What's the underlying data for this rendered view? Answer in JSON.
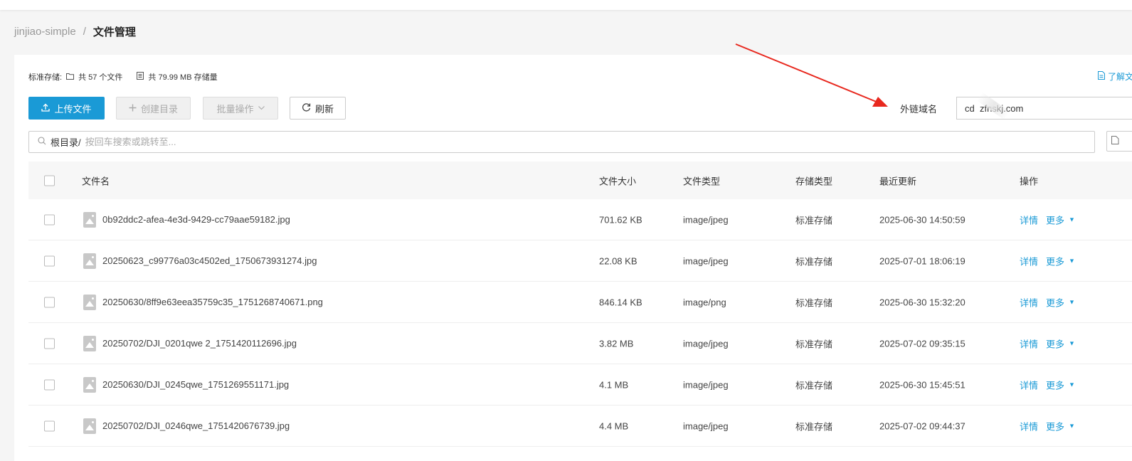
{
  "breadcrumb": {
    "root": "jinjiao-simple",
    "separator": "/",
    "current": "文件管理"
  },
  "stats": {
    "label": "标准存储:",
    "file_count": "共 57 个文件",
    "storage": "共 79.99 MB 存储量"
  },
  "learn_more": "了解文",
  "toolbar": {
    "upload": "上传文件",
    "mkdir": "创建目录",
    "batch": "批量操作",
    "refresh": "刷新"
  },
  "domain": {
    "label": "外链域名",
    "value": "cd  zfnskj.com"
  },
  "search": {
    "prefix": "根目录/",
    "placeholder": "按回车搜索或跳转至..."
  },
  "table": {
    "headers": {
      "name": "文件名",
      "size": "文件大小",
      "type": "文件类型",
      "storage": "存储类型",
      "updated": "最近更新",
      "actions": "操作"
    },
    "rows": [
      {
        "name": "0b92ddc2-afea-4e3d-9429-cc79aae59182.jpg",
        "size": "701.62 KB",
        "type": "image/jpeg",
        "storage": "标准存储",
        "updated": "2025-06-30 14:50:59",
        "detail": "详情",
        "more": "更多"
      },
      {
        "name": "20250623_c99776a03c4502ed_1750673931274.jpg",
        "size": "22.08 KB",
        "type": "image/jpeg",
        "storage": "标准存储",
        "updated": "2025-07-01 18:06:19",
        "detail": "详情",
        "more": "更多"
      },
      {
        "name": "20250630/8ff9e63eea35759c35_1751268740671.png",
        "size": "846.14 KB",
        "type": "image/png",
        "storage": "标准存储",
        "updated": "2025-06-30 15:32:20",
        "detail": "详情",
        "more": "更多"
      },
      {
        "name": "20250702/DJI_0201qwe 2_1751420112696.jpg",
        "size": "3.82 MB",
        "type": "image/jpeg",
        "storage": "标准存储",
        "updated": "2025-07-02 09:35:15",
        "detail": "详情",
        "more": "更多"
      },
      {
        "name": "20250630/DJI_0245qwe_1751269551171.jpg",
        "size": "4.1 MB",
        "type": "image/jpeg",
        "storage": "标准存储",
        "updated": "2025-06-30 15:45:51",
        "detail": "详情",
        "more": "更多"
      },
      {
        "name": "20250702/DJI_0246qwe_1751420676739.jpg",
        "size": "4.4 MB",
        "type": "image/jpeg",
        "storage": "标准存储",
        "updated": "2025-07-02 09:44:37",
        "detail": "详情",
        "more": "更多"
      }
    ]
  },
  "colors": {
    "accent": "#1a9ad6",
    "annotation_arrow": "#e8281e"
  },
  "icons": [
    "folder-icon",
    "storage-icon",
    "upload-icon",
    "plus-icon",
    "chevron-down-icon",
    "refresh-icon",
    "search-icon",
    "image-file-icon",
    "caret-down-icon",
    "doc-icon"
  ]
}
